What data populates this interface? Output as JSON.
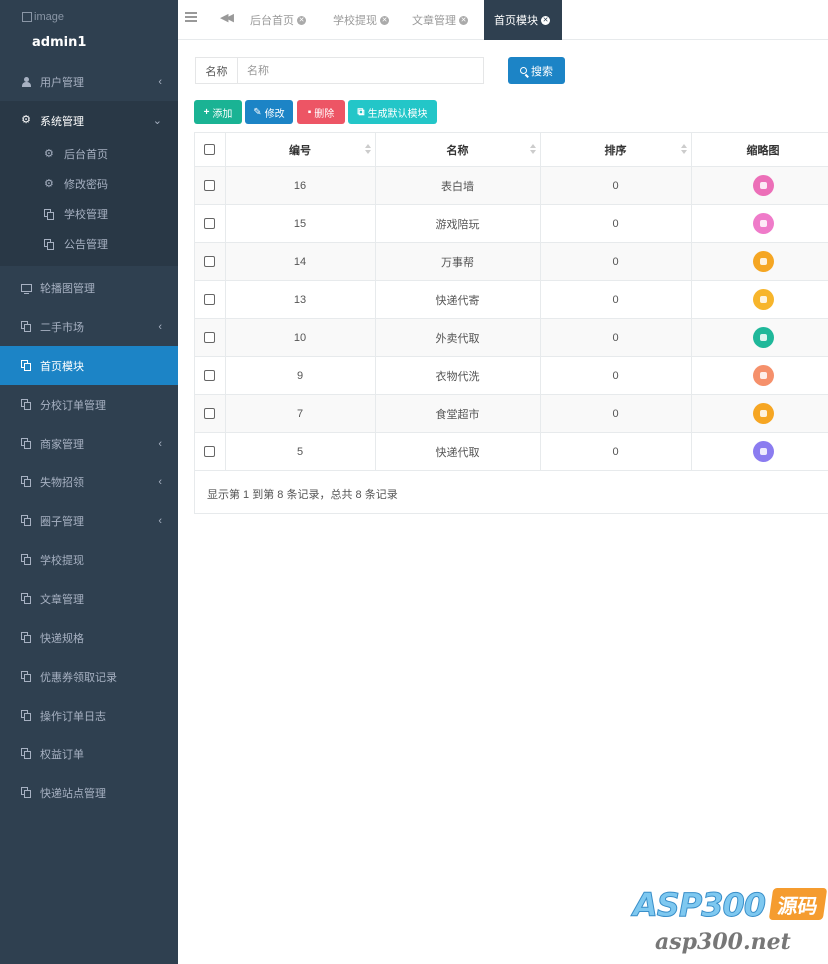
{
  "profile": {
    "avatar_alt": "image",
    "username": "admin1"
  },
  "sidebar": {
    "items": [
      {
        "label": "用户管理",
        "arrow": "‹"
      },
      {
        "label": "系统管理",
        "arrow": "⌄"
      },
      {
        "label": "轮播图管理"
      },
      {
        "label": "二手市场",
        "arrow": "‹"
      },
      {
        "label": "首页模块"
      },
      {
        "label": "分校订单管理"
      },
      {
        "label": "商家管理",
        "arrow": "‹"
      },
      {
        "label": "失物招领",
        "arrow": "‹"
      },
      {
        "label": "圈子管理",
        "arrow": "‹"
      },
      {
        "label": "学校提现"
      },
      {
        "label": "文章管理"
      },
      {
        "label": "快递规格"
      },
      {
        "label": "优惠券领取记录"
      },
      {
        "label": "操作订单日志"
      },
      {
        "label": "权益订单"
      },
      {
        "label": "快递站点管理"
      }
    ],
    "sub_items": [
      {
        "label": "后台首页"
      },
      {
        "label": "修改密码"
      },
      {
        "label": "学校管理"
      },
      {
        "label": "公告管理"
      }
    ]
  },
  "tabs": [
    {
      "label": "后台首页"
    },
    {
      "label": "学校提现"
    },
    {
      "label": "文章管理"
    },
    {
      "label": "首页模块"
    }
  ],
  "search": {
    "label": "名称",
    "placeholder": "名称",
    "value": "",
    "button": "搜索"
  },
  "toolbar": {
    "add": "添加",
    "edit": "修改",
    "delete": "删除",
    "generate": "生成默认模块"
  },
  "table": {
    "columns": [
      "编号",
      "名称",
      "排序",
      "缩略图"
    ],
    "rows": [
      {
        "id": "16",
        "name": "表白墙",
        "sort": "0",
        "thumb_color": "#ec6fb8"
      },
      {
        "id": "15",
        "name": "游戏陪玩",
        "sort": "0",
        "thumb_color": "#ef7bc9"
      },
      {
        "id": "14",
        "name": "万事帮",
        "sort": "0",
        "thumb_color": "#f5a623"
      },
      {
        "id": "13",
        "name": "快递代寄",
        "sort": "0",
        "thumb_color": "#f7b52b"
      },
      {
        "id": "10",
        "name": "外卖代取",
        "sort": "0",
        "thumb_color": "#1fb89a"
      },
      {
        "id": "9",
        "name": "衣物代洗",
        "sort": "0",
        "thumb_color": "#f5906b"
      },
      {
        "id": "7",
        "name": "食堂超市",
        "sort": "0",
        "thumb_color": "#f6a623"
      },
      {
        "id": "5",
        "name": "快递代取",
        "sort": "0",
        "thumb_color": "#8b7cf0"
      }
    ]
  },
  "pager": {
    "info": "显示第 1 到第 8 条记录，总共 8 条记录"
  },
  "watermark": {
    "brand": "ASP300",
    "badge": "源码",
    "url": "asp300.net"
  },
  "colors": {
    "sidebar": "#2f4050",
    "active": "#1c84c6",
    "add": "#1ab394",
    "delete": "#ed5565",
    "generate": "#23c6c8"
  }
}
